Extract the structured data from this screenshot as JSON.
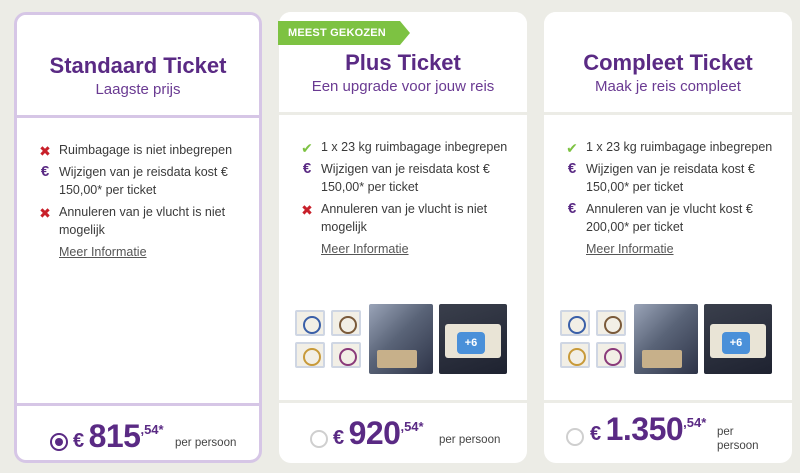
{
  "cards": [
    {
      "title": "Standaard Ticket",
      "subtitle": "Laagste prijs",
      "features": [
        {
          "icon": "x-icon",
          "text": "Ruimbagage is niet inbegrepen"
        },
        {
          "icon": "euro-icon",
          "text": "Wijzigen van je reisdata kost € 150,00* per ticket"
        },
        {
          "icon": "x-icon",
          "text": "Annuleren van je vlucht is niet mogelijk"
        }
      ],
      "more_label": "Meer Informatie",
      "price": {
        "currency": "€",
        "amount": "815",
        "decimals": ",54*",
        "per": "per persoon"
      },
      "selected": true
    },
    {
      "badge": "MEEST GEKOZEN",
      "title": "Plus Ticket",
      "subtitle": "Een upgrade voor jouw reis",
      "features": [
        {
          "icon": "check-icon",
          "text": "1 x 23 kg ruimbagage inbegrepen"
        },
        {
          "icon": "euro-icon",
          "text": "Wijzigen van je reisdata kost € 150,00* per ticket"
        },
        {
          "icon": "x-icon",
          "text": "Annuleren van je vlucht is niet mogelijk"
        }
      ],
      "more_label": "Meer Informatie",
      "meals_more": "+6",
      "price": {
        "currency": "€",
        "amount": "920",
        "decimals": ",54*",
        "per": "per persoon"
      },
      "selected": false
    },
    {
      "title": "Compleet Ticket",
      "subtitle": "Maak je reis compleet",
      "features": [
        {
          "icon": "check-icon",
          "text": "1 x 23 kg ruimbagage inbegrepen"
        },
        {
          "icon": "euro-icon",
          "text": "Wijzigen van je reisdata kost € 150,00* per ticket"
        },
        {
          "icon": "euro-icon",
          "text": "Annuleren van je vlucht kost € 200,00* per ticket"
        }
      ],
      "more_label": "Meer Informatie",
      "meals_more": "+6",
      "price": {
        "currency": "€",
        "amount": "1.350",
        "decimals": ",54*",
        "per_line1": "per",
        "per_line2": "persoon"
      },
      "selected": false
    }
  ],
  "colors": {
    "brand": "#5a2a84",
    "badge": "#7dc242",
    "error": "#c8202a",
    "check": "#7dc242"
  }
}
